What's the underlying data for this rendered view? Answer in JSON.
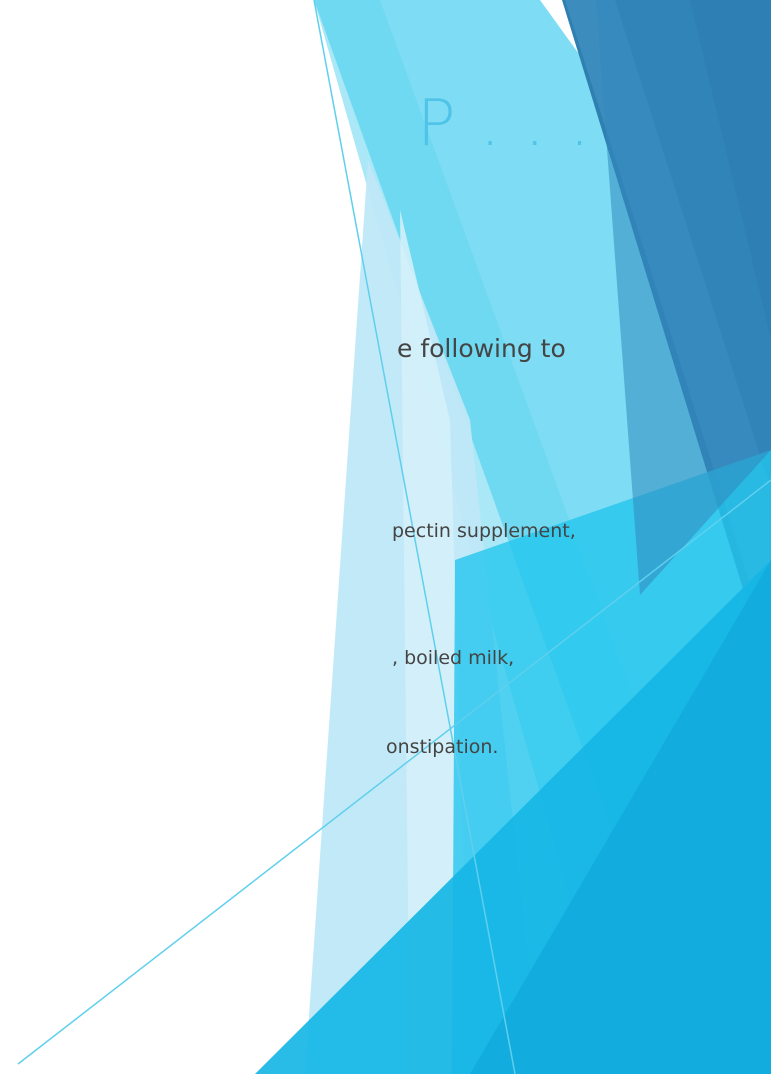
{
  "slide": {
    "title": "P . . .",
    "lines": [
      "e following to",
      " pectin supplement,",
      ", boiled milk,",
      "onstipation."
    ]
  },
  "colors": {
    "title": "#4fc3e8",
    "body_text": "#444444",
    "accent_light": "#78dcf2",
    "accent_mid": "#1fc2ec",
    "accent_dark": "#2e7fb2"
  }
}
